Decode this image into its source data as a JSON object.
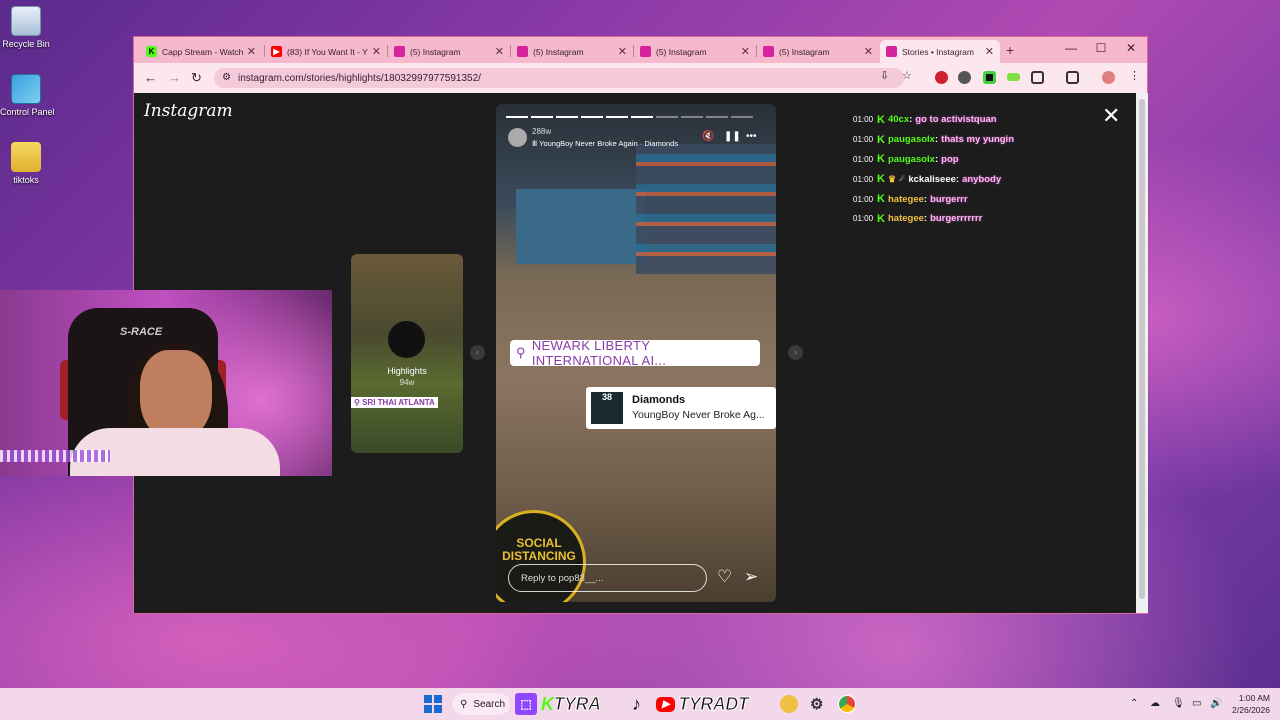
{
  "desktop": {
    "icons": [
      {
        "label": "Recycle Bin",
        "icon": "recycle-bin-icon"
      },
      {
        "label": "Control Panel",
        "icon": "control-panel-icon"
      },
      {
        "label": "tiktoks",
        "icon": "folder-icon"
      }
    ]
  },
  "browser": {
    "tabs": [
      {
        "title": "Capp Stream - Watch",
        "icon": "kick-icon",
        "color": "#53fc18"
      },
      {
        "title": "(83) If You Want It - Y",
        "icon": "youtube-icon",
        "color": "#ff0000"
      },
      {
        "title": "(5) Instagram",
        "icon": "instagram-icon",
        "color": "#d6249f"
      },
      {
        "title": "(5) Instagram",
        "icon": "instagram-icon",
        "color": "#d6249f"
      },
      {
        "title": "(5) Instagram",
        "icon": "instagram-icon",
        "color": "#d6249f"
      },
      {
        "title": "(5) Instagram",
        "icon": "instagram-icon",
        "color": "#d6249f"
      },
      {
        "title": "Stories • Instagram",
        "icon": "instagram-icon",
        "color": "#d6249f",
        "active": true
      }
    ],
    "url": "instagram.com/stories/highlights/18032997977591352/"
  },
  "instagram": {
    "logo": "Instagram",
    "side_card": {
      "label": "Highlights",
      "age": "94w",
      "location": "SRI THAI ATLANTA"
    },
    "story": {
      "time": "288w",
      "song": "YoungBoy Never Broke Again · Diamonds",
      "location_sticker": "NEWARK LIBERTY INTERNATIONAL AI...",
      "music_sticker": {
        "art_text": "38",
        "title": "Diamonds",
        "artist": "YoungBoy Never Broke Ag..."
      },
      "floor_sticker": "SOCIAL DISTANCING",
      "reply_placeholder": "Reply to pop83__..."
    }
  },
  "chat": [
    {
      "time": "01:00",
      "user": "40cx",
      "user_color": "#53fc18",
      "message": "go to activistquan"
    },
    {
      "time": "01:00",
      "user": "paugasolx",
      "user_color": "#53fc18",
      "message": "thats my yungin"
    },
    {
      "time": "01:00",
      "user": "paugasolx",
      "user_color": "#53fc18",
      "message": "pop"
    },
    {
      "time": "01:00",
      "user": "kckaliseee",
      "user_color": "#ffffff",
      "message": "anybody",
      "badges": true
    },
    {
      "time": "01:00",
      "user": "hategee",
      "user_color": "#f0c040",
      "message": "burgerrr"
    },
    {
      "time": "01:00",
      "user": "hategee",
      "user_color": "#f0c040",
      "message": "burgerrrrrrr"
    }
  ],
  "webcam": {
    "chair_brand": "S-RACE"
  },
  "taskbar": {
    "search_label": "Search",
    "kick_label": "TYRA",
    "youtube_label": "TYRADT",
    "time": "1:00 AM",
    "date": "2/26/2026"
  }
}
